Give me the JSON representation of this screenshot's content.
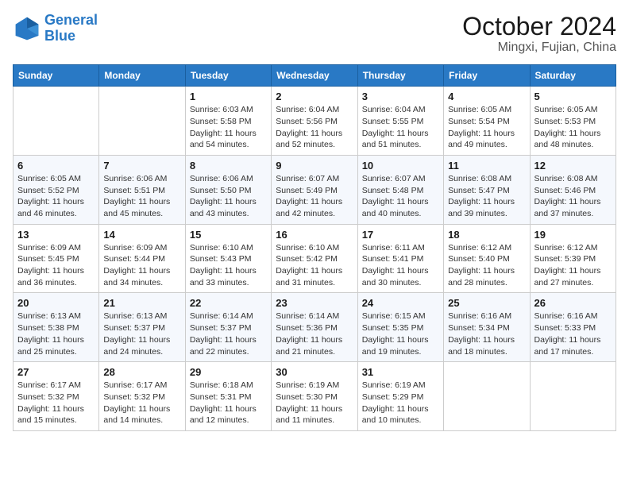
{
  "logo": {
    "text_general": "General",
    "text_blue": "Blue"
  },
  "title": "October 2024",
  "subtitle": "Mingxi, Fujian, China",
  "days_of_week": [
    "Sunday",
    "Monday",
    "Tuesday",
    "Wednesday",
    "Thursday",
    "Friday",
    "Saturday"
  ],
  "weeks": [
    [
      {
        "day": "",
        "sunrise": "",
        "sunset": "",
        "daylight": ""
      },
      {
        "day": "",
        "sunrise": "",
        "sunset": "",
        "daylight": ""
      },
      {
        "day": "1",
        "sunrise": "Sunrise: 6:03 AM",
        "sunset": "Sunset: 5:58 PM",
        "daylight": "Daylight: 11 hours and 54 minutes."
      },
      {
        "day": "2",
        "sunrise": "Sunrise: 6:04 AM",
        "sunset": "Sunset: 5:56 PM",
        "daylight": "Daylight: 11 hours and 52 minutes."
      },
      {
        "day": "3",
        "sunrise": "Sunrise: 6:04 AM",
        "sunset": "Sunset: 5:55 PM",
        "daylight": "Daylight: 11 hours and 51 minutes."
      },
      {
        "day": "4",
        "sunrise": "Sunrise: 6:05 AM",
        "sunset": "Sunset: 5:54 PM",
        "daylight": "Daylight: 11 hours and 49 minutes."
      },
      {
        "day": "5",
        "sunrise": "Sunrise: 6:05 AM",
        "sunset": "Sunset: 5:53 PM",
        "daylight": "Daylight: 11 hours and 48 minutes."
      }
    ],
    [
      {
        "day": "6",
        "sunrise": "Sunrise: 6:05 AM",
        "sunset": "Sunset: 5:52 PM",
        "daylight": "Daylight: 11 hours and 46 minutes."
      },
      {
        "day": "7",
        "sunrise": "Sunrise: 6:06 AM",
        "sunset": "Sunset: 5:51 PM",
        "daylight": "Daylight: 11 hours and 45 minutes."
      },
      {
        "day": "8",
        "sunrise": "Sunrise: 6:06 AM",
        "sunset": "Sunset: 5:50 PM",
        "daylight": "Daylight: 11 hours and 43 minutes."
      },
      {
        "day": "9",
        "sunrise": "Sunrise: 6:07 AM",
        "sunset": "Sunset: 5:49 PM",
        "daylight": "Daylight: 11 hours and 42 minutes."
      },
      {
        "day": "10",
        "sunrise": "Sunrise: 6:07 AM",
        "sunset": "Sunset: 5:48 PM",
        "daylight": "Daylight: 11 hours and 40 minutes."
      },
      {
        "day": "11",
        "sunrise": "Sunrise: 6:08 AM",
        "sunset": "Sunset: 5:47 PM",
        "daylight": "Daylight: 11 hours and 39 minutes."
      },
      {
        "day": "12",
        "sunrise": "Sunrise: 6:08 AM",
        "sunset": "Sunset: 5:46 PM",
        "daylight": "Daylight: 11 hours and 37 minutes."
      }
    ],
    [
      {
        "day": "13",
        "sunrise": "Sunrise: 6:09 AM",
        "sunset": "Sunset: 5:45 PM",
        "daylight": "Daylight: 11 hours and 36 minutes."
      },
      {
        "day": "14",
        "sunrise": "Sunrise: 6:09 AM",
        "sunset": "Sunset: 5:44 PM",
        "daylight": "Daylight: 11 hours and 34 minutes."
      },
      {
        "day": "15",
        "sunrise": "Sunrise: 6:10 AM",
        "sunset": "Sunset: 5:43 PM",
        "daylight": "Daylight: 11 hours and 33 minutes."
      },
      {
        "day": "16",
        "sunrise": "Sunrise: 6:10 AM",
        "sunset": "Sunset: 5:42 PM",
        "daylight": "Daylight: 11 hours and 31 minutes."
      },
      {
        "day": "17",
        "sunrise": "Sunrise: 6:11 AM",
        "sunset": "Sunset: 5:41 PM",
        "daylight": "Daylight: 11 hours and 30 minutes."
      },
      {
        "day": "18",
        "sunrise": "Sunrise: 6:12 AM",
        "sunset": "Sunset: 5:40 PM",
        "daylight": "Daylight: 11 hours and 28 minutes."
      },
      {
        "day": "19",
        "sunrise": "Sunrise: 6:12 AM",
        "sunset": "Sunset: 5:39 PM",
        "daylight": "Daylight: 11 hours and 27 minutes."
      }
    ],
    [
      {
        "day": "20",
        "sunrise": "Sunrise: 6:13 AM",
        "sunset": "Sunset: 5:38 PM",
        "daylight": "Daylight: 11 hours and 25 minutes."
      },
      {
        "day": "21",
        "sunrise": "Sunrise: 6:13 AM",
        "sunset": "Sunset: 5:37 PM",
        "daylight": "Daylight: 11 hours and 24 minutes."
      },
      {
        "day": "22",
        "sunrise": "Sunrise: 6:14 AM",
        "sunset": "Sunset: 5:37 PM",
        "daylight": "Daylight: 11 hours and 22 minutes."
      },
      {
        "day": "23",
        "sunrise": "Sunrise: 6:14 AM",
        "sunset": "Sunset: 5:36 PM",
        "daylight": "Daylight: 11 hours and 21 minutes."
      },
      {
        "day": "24",
        "sunrise": "Sunrise: 6:15 AM",
        "sunset": "Sunset: 5:35 PM",
        "daylight": "Daylight: 11 hours and 19 minutes."
      },
      {
        "day": "25",
        "sunrise": "Sunrise: 6:16 AM",
        "sunset": "Sunset: 5:34 PM",
        "daylight": "Daylight: 11 hours and 18 minutes."
      },
      {
        "day": "26",
        "sunrise": "Sunrise: 6:16 AM",
        "sunset": "Sunset: 5:33 PM",
        "daylight": "Daylight: 11 hours and 17 minutes."
      }
    ],
    [
      {
        "day": "27",
        "sunrise": "Sunrise: 6:17 AM",
        "sunset": "Sunset: 5:32 PM",
        "daylight": "Daylight: 11 hours and 15 minutes."
      },
      {
        "day": "28",
        "sunrise": "Sunrise: 6:17 AM",
        "sunset": "Sunset: 5:32 PM",
        "daylight": "Daylight: 11 hours and 14 minutes."
      },
      {
        "day": "29",
        "sunrise": "Sunrise: 6:18 AM",
        "sunset": "Sunset: 5:31 PM",
        "daylight": "Daylight: 11 hours and 12 minutes."
      },
      {
        "day": "30",
        "sunrise": "Sunrise: 6:19 AM",
        "sunset": "Sunset: 5:30 PM",
        "daylight": "Daylight: 11 hours and 11 minutes."
      },
      {
        "day": "31",
        "sunrise": "Sunrise: 6:19 AM",
        "sunset": "Sunset: 5:29 PM",
        "daylight": "Daylight: 11 hours and 10 minutes."
      },
      {
        "day": "",
        "sunrise": "",
        "sunset": "",
        "daylight": ""
      },
      {
        "day": "",
        "sunrise": "",
        "sunset": "",
        "daylight": ""
      }
    ]
  ]
}
